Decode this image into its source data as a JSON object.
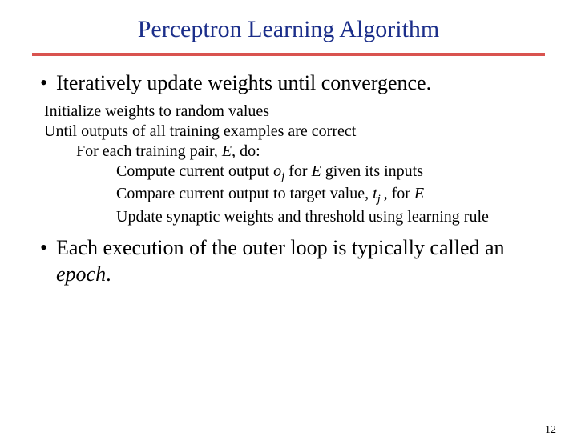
{
  "title": "Perceptron Learning Algorithm",
  "bullets": {
    "b1": "Iteratively update weights until convergence.",
    "b2_pre": "Each execution of the outer loop is typically called an ",
    "b2_em": "epoch",
    "b2_post": "."
  },
  "pseudo": {
    "l0": "Initialize weights to random values",
    "l1": "Until outputs of all training examples are correct",
    "l2_pre": "For each training pair, ",
    "l2_E": "E",
    "l2_post": ", do:",
    "l3a_pre": "Compute current output ",
    "l3a_o": "o",
    "l3a_j": "j",
    "l3a_mid": " for ",
    "l3a_E": "E",
    "l3a_post": " given its inputs",
    "l3b_pre": "Compare current output to target value, ",
    "l3b_t": "t",
    "l3b_j": "j ",
    "l3b_coma": ",",
    "l3b_mid": " for ",
    "l3b_E": "E",
    "l3c": "Update synaptic weights and threshold using learning rule"
  },
  "page_number": "12",
  "glyphs": {
    "bullet": "•"
  }
}
